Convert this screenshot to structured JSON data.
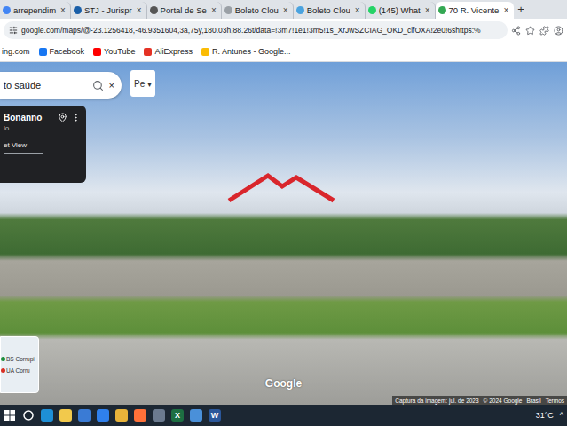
{
  "tabs": [
    {
      "label": "arrependim",
      "close": "×",
      "selected": false,
      "color": "#4285f4"
    },
    {
      "label": "STJ - Jurispr",
      "close": "×",
      "selected": false,
      "color": "#1a5fa8"
    },
    {
      "label": "Portal de Se",
      "close": "×",
      "selected": false,
      "color": "#555555"
    },
    {
      "label": "Boleto Clou",
      "close": "×",
      "selected": false,
      "color": "#9aa0a6"
    },
    {
      "label": "Boleto Clou",
      "close": "×",
      "selected": false,
      "color": "#4aa3df"
    },
    {
      "label": "(145) What",
      "close": "×",
      "selected": false,
      "color": "#25d366"
    },
    {
      "label": "70 R. Vicente",
      "close": "×",
      "selected": true,
      "color": "#34a853"
    }
  ],
  "new_tab": "+",
  "address": {
    "url": "google.com/maps/@-23.1256418,-46.9351604,3a,75y,180.03h,88.26t/data=!3m7!1e1!3m5!1s_XrJwSZCIAG_OKD_clfOXA!2e0!6shttps:%"
  },
  "bookmarks": [
    {
      "label": "ing.com",
      "color": "none"
    },
    {
      "label": "Facebook",
      "color": "#1877f2"
    },
    {
      "label": "YouTube",
      "color": "#ff0000"
    },
    {
      "label": "AliExpress",
      "color": "#e43225"
    },
    {
      "label": "R. Antunes - Google...",
      "color": "#fbbc05"
    }
  ],
  "search": {
    "value": "to saúde",
    "clear": "×"
  },
  "layers_button": {
    "label": "Pe",
    "caret": "▾"
  },
  "place_card": {
    "title": "Bonanno",
    "subtitle": "lo",
    "link": "et View"
  },
  "minimap": {
    "places": [
      {
        "label": "BS Corrupi",
        "color": "#1e8e3e"
      },
      {
        "label": "UA Corru",
        "color": "#d93025"
      }
    ]
  },
  "watermark": "Google",
  "footer": [
    "Captura da imagem: jul. de 2023",
    "© 2024 Google",
    "Brasil",
    "Termos"
  ],
  "taskbar": {
    "apps": [
      {
        "name": "edge",
        "color": "#1e8fd6",
        "glyph": ""
      },
      {
        "name": "explorer",
        "color": "#f2c94c",
        "glyph": ""
      },
      {
        "name": "store",
        "color": "#3a7bd5",
        "glyph": ""
      },
      {
        "name": "mail",
        "color": "#2f80ed",
        "glyph": ""
      },
      {
        "name": "chrome",
        "color": "#e8b33a",
        "glyph": ""
      },
      {
        "name": "firefox",
        "color": "#ff7139",
        "glyph": ""
      },
      {
        "name": "app",
        "color": "#6b7a8f",
        "glyph": ""
      },
      {
        "name": "excel",
        "color": "#1d6f42",
        "glyph": "X"
      },
      {
        "name": "photos",
        "color": "#4a90d9",
        "glyph": ""
      },
      {
        "name": "word",
        "color": "#2b579a",
        "glyph": "W"
      }
    ],
    "weather": "31°C",
    "tray": "^"
  }
}
